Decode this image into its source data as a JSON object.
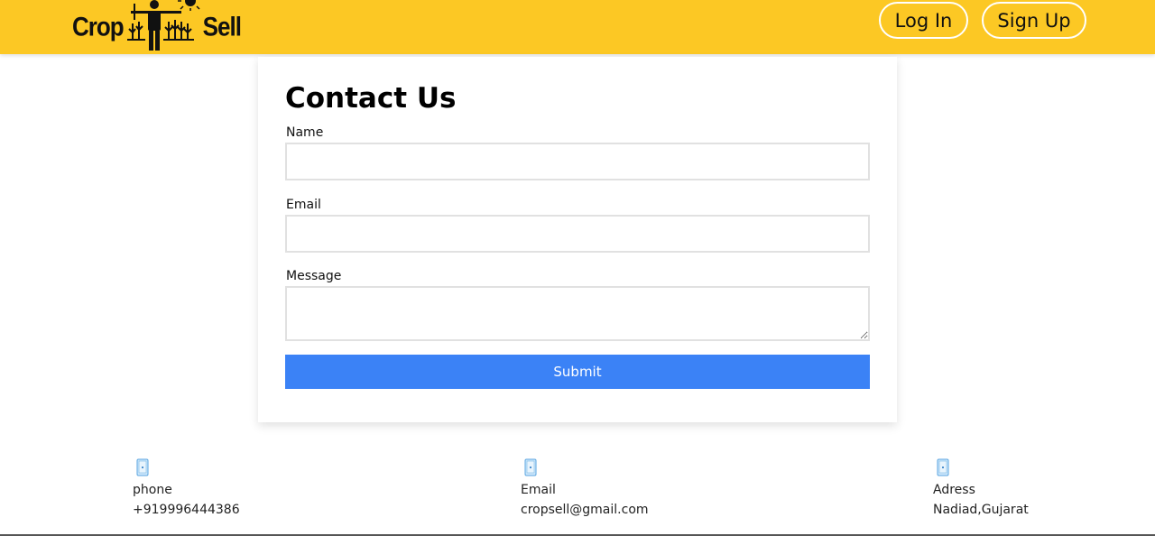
{
  "brand": {
    "left_word": "Crop",
    "right_word": "Sell",
    "color": "#fcc824"
  },
  "nav": {
    "login_label": "Log In",
    "signup_label": "Sign Up"
  },
  "form": {
    "title": "Contact Us",
    "name_label": "Name",
    "name_value": "",
    "email_label": "Email",
    "email_value": "",
    "message_label": "Message",
    "message_value": "",
    "submit_label": "Submit",
    "submit_color": "#3b82f6"
  },
  "contacts": [
    {
      "icon": "phone-icon",
      "title": "phone",
      "value": "+919996444386"
    },
    {
      "icon": "phone-icon",
      "title": "Email",
      "value": "cropsell@gmail.com"
    },
    {
      "icon": "phone-icon",
      "title": "Adress",
      "value": "Nadiad,Gujarat"
    }
  ]
}
